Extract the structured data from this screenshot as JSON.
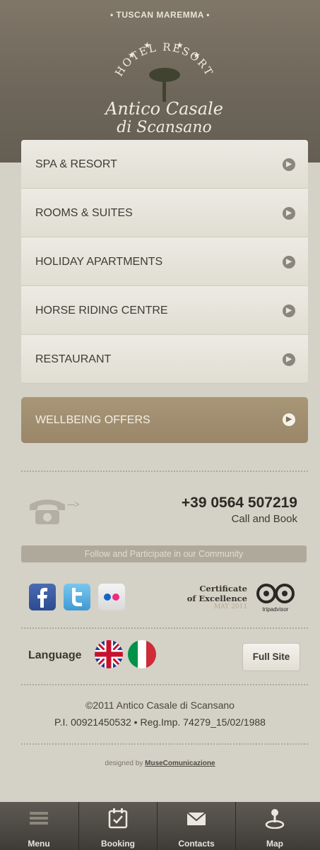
{
  "header": {
    "tagline": "• TUSCAN MAREMMA •",
    "logo_top": "HOTEL RESORT",
    "logo_line1": "Antico Casale",
    "logo_line2": "di Scansano"
  },
  "menu": {
    "items": [
      {
        "label": "SPA & RESORT"
      },
      {
        "label": "ROOMS & SUITES"
      },
      {
        "label": "HOLIDAY APARTMENTS"
      },
      {
        "label": "HORSE RIDING CENTRE"
      },
      {
        "label": "RESTAURANT"
      }
    ],
    "offers_label": "WELLBEING OFFERS"
  },
  "contact": {
    "phone": "+39 0564 507219",
    "call_label": "Call and Book",
    "arrow": "--->"
  },
  "community": {
    "label": "Follow and Participate in our Community",
    "certificate_line1": "Certificate",
    "certificate_line2": "of Excellence",
    "certificate_date": "MAY 2011",
    "tripadvisor_label": "tripadvisor"
  },
  "language": {
    "label": "Language",
    "full_site": "Full Site"
  },
  "footer": {
    "copyright": "©2011 Antico Casale di Scansano",
    "registration": "P.I. 00921450532 • Reg.Imp. 74279_15/02/1988",
    "designed_by": "designed by",
    "designer": "MuseComunicazione"
  },
  "tabbar": {
    "tabs": [
      {
        "label": "Menu",
        "icon": "menu-icon"
      },
      {
        "label": "Booking",
        "icon": "calendar-icon"
      },
      {
        "label": "Contacts",
        "icon": "envelope-icon"
      },
      {
        "label": "Map",
        "icon": "map-pin-icon"
      }
    ]
  },
  "colors": {
    "header_bg": "#6d6559",
    "background": "#d4d1c6",
    "offers_accent": "#9a8669"
  }
}
